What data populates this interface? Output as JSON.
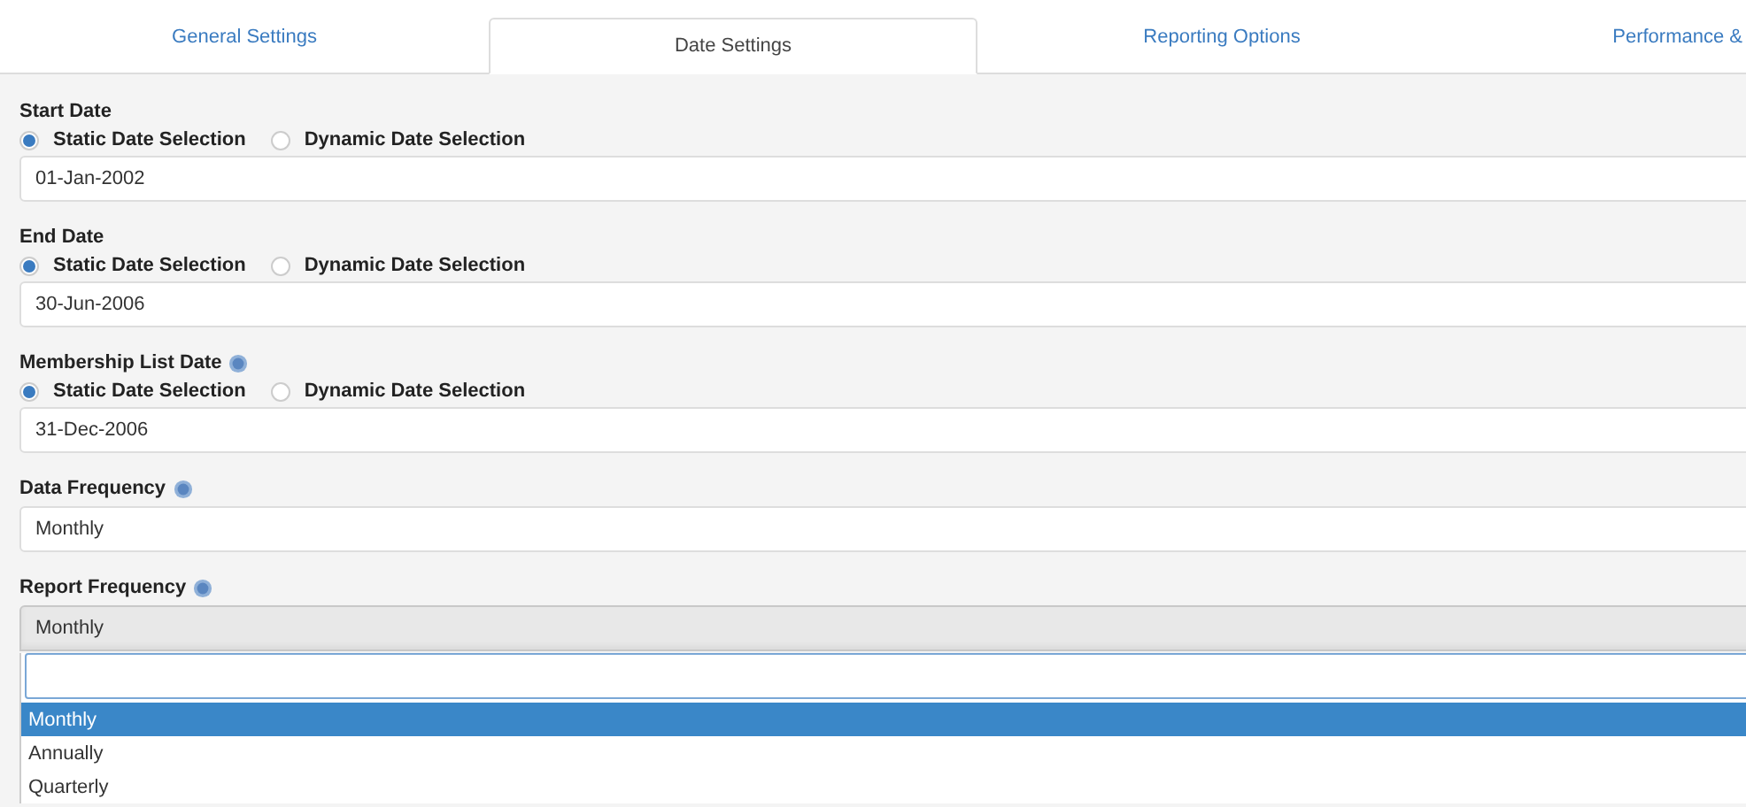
{
  "tabs": [
    {
      "label": "General Settings",
      "selected": false
    },
    {
      "label": "Date Settings",
      "selected": true
    },
    {
      "label": "Reporting Options",
      "selected": false
    },
    {
      "label": "Performance &",
      "selected": false
    }
  ],
  "fields": [
    {
      "kind": "date",
      "label": "Start Date",
      "help": false,
      "options": [
        {
          "label": "Static Date Selection",
          "selected": true
        },
        {
          "label": "Dynamic Date Selection",
          "selected": false
        }
      ],
      "value": "01-Jan-2002"
    },
    {
      "kind": "date",
      "label": "End Date",
      "help": false,
      "options": [
        {
          "label": "Static Date Selection",
          "selected": true
        },
        {
          "label": "Dynamic Date Selection",
          "selected": false
        }
      ],
      "value": "30-Jun-2006"
    },
    {
      "kind": "date",
      "label": "Membership List Date",
      "help": true,
      "options": [
        {
          "label": "Static Date Selection",
          "selected": true
        },
        {
          "label": "Dynamic Date Selection",
          "selected": false
        }
      ],
      "value": "31-Dec-2006"
    },
    {
      "kind": "select",
      "label": "Data Frequency",
      "help": true,
      "value": "Monthly",
      "open": false
    },
    {
      "kind": "select",
      "label": "Report Frequency",
      "help": true,
      "value": "Monthly",
      "open": true,
      "choices": [
        {
          "label": "Monthly",
          "selected": true
        },
        {
          "label": "Annually",
          "selected": false
        },
        {
          "label": "Quarterly",
          "selected": false
        }
      ]
    }
  ]
}
